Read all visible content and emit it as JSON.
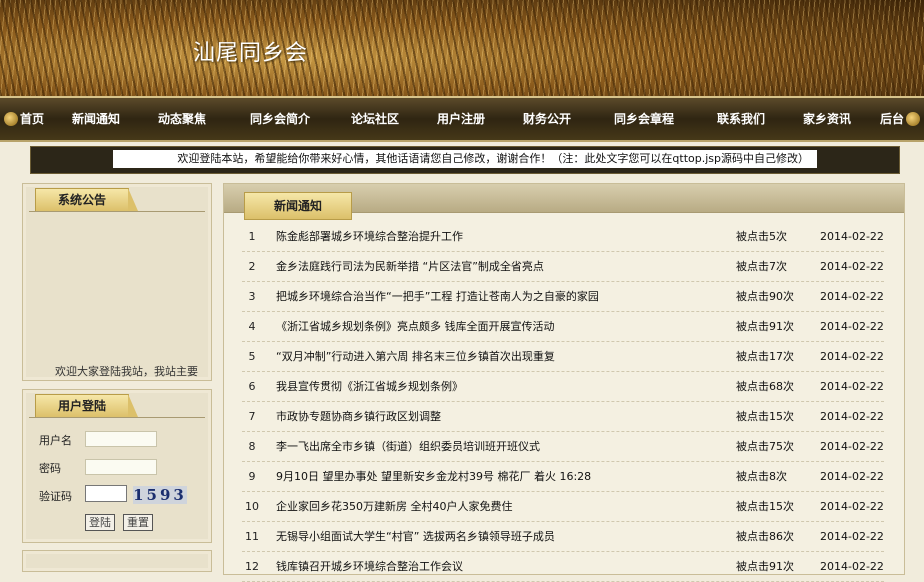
{
  "header": {
    "site_title": "汕尾同乡会"
  },
  "nav": [
    {
      "label": "首页"
    },
    {
      "label": "新闻通知"
    },
    {
      "label": "动态聚焦"
    },
    {
      "label": "同乡会简介"
    },
    {
      "label": "论坛社区"
    },
    {
      "label": "用户注册"
    },
    {
      "label": "财务公开"
    },
    {
      "label": "同乡会章程"
    },
    {
      "label": "联系我们"
    },
    {
      "label": "家乡资讯"
    },
    {
      "label": "后台"
    }
  ],
  "welcome_text": "欢迎登陆本站，希望能给你带来好心情，其他话语请您自己修改，谢谢合作！（注：此处文字您可以在qttop.jsp源码中自己修改）",
  "notice": {
    "title": "系统公告",
    "text": "欢迎大家登陆我站，我站主要"
  },
  "login": {
    "title": "用户登陆",
    "username_label": "用户名",
    "password_label": "密码",
    "captcha_label": "验证码",
    "captcha_value": "1593",
    "login_button": "登陆",
    "reset_button": "重置"
  },
  "news": {
    "title": "新闻通知",
    "rows": [
      {
        "num": "1",
        "title": "陈金彪部署城乡环境综合整治提升工作",
        "clicks": "被点击5次",
        "date": "2014-02-22"
      },
      {
        "num": "2",
        "title": "金乡法庭践行司法为民新举措 “片区法官”制成全省亮点",
        "clicks": "被点击7次",
        "date": "2014-02-22"
      },
      {
        "num": "3",
        "title": "把城乡环境综合治当作“一把手”工程 打造让苍南人为之自豪的家园",
        "clicks": "被点击90次",
        "date": "2014-02-22"
      },
      {
        "num": "4",
        "title": "《浙江省城乡规划条例》亮点颇多 钱库全面开展宣传活动",
        "clicks": "被点击91次",
        "date": "2014-02-22"
      },
      {
        "num": "5",
        "title": "“双月冲制”行动进入第六周 排名末三位乡镇首次出现重复",
        "clicks": "被点击17次",
        "date": "2014-02-22"
      },
      {
        "num": "6",
        "title": "我县宣传贯彻《浙江省城乡规划条例》",
        "clicks": "被点击68次",
        "date": "2014-02-22"
      },
      {
        "num": "7",
        "title": "市政协专题协商乡镇行政区划调整",
        "clicks": "被点击15次",
        "date": "2014-02-22"
      },
      {
        "num": "8",
        "title": "李一飞出席全市乡镇（街道）组织委员培训班开班仪式",
        "clicks": "被点击75次",
        "date": "2014-02-22"
      },
      {
        "num": "9",
        "title": "9月10日 望里办事处 望里新安乡金龙村39号 棉花厂 着火 16:28",
        "clicks": "被点击8次",
        "date": "2014-02-22"
      },
      {
        "num": "10",
        "title": "企业家回乡花350万建新房 全村40户人家免费住",
        "clicks": "被点击15次",
        "date": "2014-02-22"
      },
      {
        "num": "11",
        "title": "无锡导小组面试大学生“村官” 选拔两名乡镇领导班子成员",
        "clicks": "被点击86次",
        "date": "2014-02-22"
      },
      {
        "num": "12",
        "title": "钱库镇召开城乡环境综合整治工作会议",
        "clicks": "被点击91次",
        "date": "2014-02-22"
      }
    ]
  }
}
